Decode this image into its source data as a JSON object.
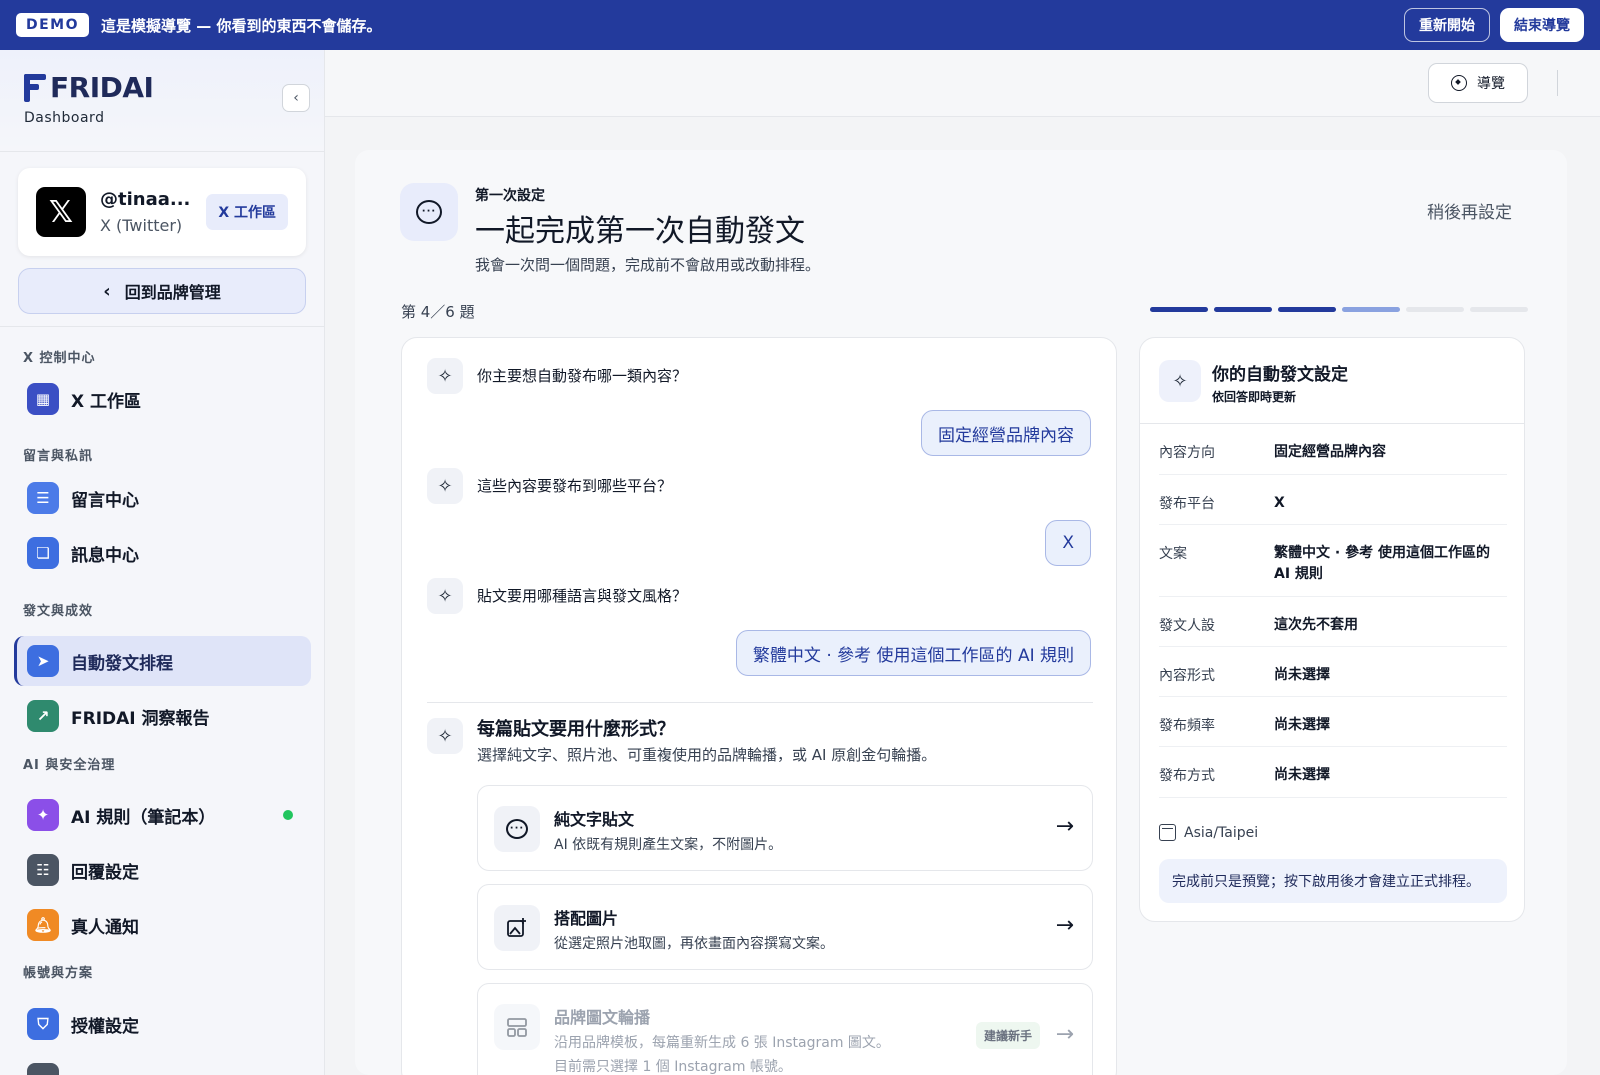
{
  "banner": {
    "tag": "DEMO",
    "text": "這是模擬導覽 — 你看到的東西不會儲存。",
    "restart": "重新開始",
    "end": "結束導覽"
  },
  "sidebar": {
    "logo": "FRIDAI",
    "subtitle": "Dashboard",
    "account": {
      "handle": "@tinaa...",
      "platform": "X (Twitter)",
      "chip": "X 工作區"
    },
    "back": "回到品牌管理",
    "sections": [
      {
        "label": "X 控制中心",
        "items": [
          {
            "label": "X 工作區",
            "icon": "grid-icon",
            "color": "#3b4fc4"
          }
        ]
      },
      {
        "label": "留言與私訊",
        "items": [
          {
            "label": "留言中心",
            "icon": "comment-icon",
            "color": "#4c7be8"
          },
          {
            "label": "訊息中心",
            "icon": "messages-icon",
            "color": "#3d6ee0"
          }
        ]
      },
      {
        "label": "發文與成效",
        "items": [
          {
            "label": "自動發文排程",
            "icon": "send-icon",
            "color": "#3d6ee0",
            "active": true
          },
          {
            "label": "FRIDAI 洞察報告",
            "icon": "trend-icon",
            "color": "#2f8a6e"
          }
        ]
      },
      {
        "label": "AI 與安全治理",
        "items": [
          {
            "label": "AI 規則（筆記本）",
            "icon": "sparkle-icon",
            "color": "#8b4fe8",
            "status": "online"
          },
          {
            "label": "回覆設定",
            "icon": "sliders-icon",
            "color": "#4b5563"
          },
          {
            "label": "真人通知",
            "icon": "bell-icon",
            "color": "#f08a24"
          }
        ]
      },
      {
        "label": "帳號與方案",
        "items": [
          {
            "label": "授權設定",
            "icon": "shield-icon",
            "color": "#3d6ee0"
          }
        ]
      }
    ]
  },
  "topbar": {
    "guide": "導覽"
  },
  "header": {
    "eyebrow": "第一次設定",
    "title": "一起完成第一次自動發文",
    "subtitle": "我會一次問一個問題，完成前不會啟用或改動排程。",
    "later": "稍後再設定"
  },
  "progress": {
    "label": "第 4／6 題",
    "current": 4,
    "total": 6
  },
  "chat": {
    "qa": [
      {
        "q": "你主要想自動發布哪一類內容？",
        "a": "固定經營品牌內容"
      },
      {
        "q": "這些內容要發布到哪些平台？",
        "a": "X"
      },
      {
        "q": "貼文要用哪種語言與發文風格？",
        "a": "繁體中文 · 參考 使用這個工作區的 AI 規則"
      }
    ],
    "current_q": "每篇貼文要用什麼形式？",
    "current_desc": "選擇純文字、照片池、可重複使用的品牌輪播，或 AI 原創金句輪播。",
    "options": [
      {
        "title": "純文字貼文",
        "desc": "AI 依既有規則產生文案，不附圖片。",
        "icon": "chat-bubble-icon"
      },
      {
        "title": "搭配圖片",
        "desc": "從選定照片池取圖，再依畫面內容撰寫文案。",
        "icon": "image-add-icon"
      },
      {
        "title": "品牌圖文輪播",
        "desc": "沿用品牌模板，每篇重新生成 6 張 Instagram 圖文。",
        "desc2": "目前需只選擇 1 個 Instagram 帳號。",
        "tag": "建議新手",
        "icon": "layout-icon"
      }
    ]
  },
  "settings": {
    "title": "你的自動發文設定",
    "subtitle": "依回答即時更新",
    "rows": [
      {
        "k": "內容方向",
        "v": "固定經營品牌內容"
      },
      {
        "k": "發布平台",
        "v": "X"
      },
      {
        "k": "文案",
        "v": "繁體中文 · 參考 使用這個工作區的 AI 規則"
      },
      {
        "k": "發文人設",
        "v": "這次先不套用"
      },
      {
        "k": "內容形式",
        "v": "尚未選擇"
      },
      {
        "k": "發布頻率",
        "v": "尚未選擇"
      },
      {
        "k": "發布方式",
        "v": "尚未選擇"
      }
    ],
    "timezone": "Asia/Taipei",
    "note": "完成前只是預覽；按下啟用後才會建立正式排程。"
  }
}
